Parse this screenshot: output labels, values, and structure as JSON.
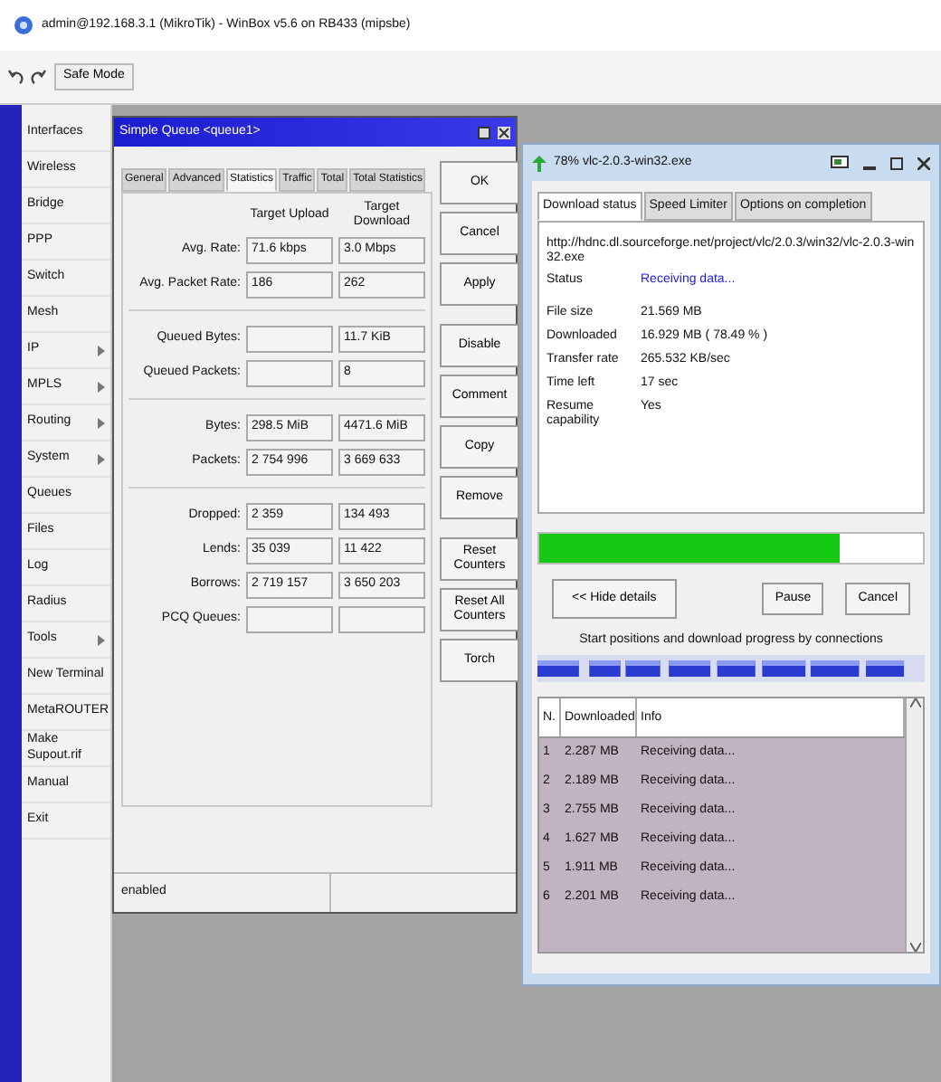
{
  "window": {
    "title": "admin@192.168.3.1 (MikroTik) - WinBox v5.6 on RB433 (mipsbe)"
  },
  "toolbar": {
    "buttons": [
      "Safe Mode"
    ]
  },
  "sidebar": {
    "items": [
      {
        "label": "Interfaces",
        "submenu": false
      },
      {
        "label": "Wireless",
        "submenu": false
      },
      {
        "label": "Bridge",
        "submenu": false
      },
      {
        "label": "PPP",
        "submenu": false
      },
      {
        "label": "Switch",
        "submenu": false
      },
      {
        "label": "Mesh",
        "submenu": false
      },
      {
        "label": "IP",
        "submenu": true
      },
      {
        "label": "MPLS",
        "submenu": true
      },
      {
        "label": "Routing",
        "submenu": true
      },
      {
        "label": "System",
        "submenu": true
      },
      {
        "label": "Queues",
        "submenu": false
      },
      {
        "label": "Files",
        "submenu": false
      },
      {
        "label": "Log",
        "submenu": false
      },
      {
        "label": "Radius",
        "submenu": false
      },
      {
        "label": "Tools",
        "submenu": true
      },
      {
        "label": "New Terminal",
        "submenu": false
      },
      {
        "label": "MetaROUTER",
        "submenu": false
      },
      {
        "label": "Make Supout.rif",
        "submenu": false
      },
      {
        "label": "Manual",
        "submenu": false
      },
      {
        "label": "Exit",
        "submenu": false
      }
    ]
  },
  "queue_dialog": {
    "title": "Simple Queue <queue1>",
    "tabs": [
      {
        "label": "General",
        "selected": false
      },
      {
        "label": "Advanced",
        "selected": false
      },
      {
        "label": "Statistics",
        "selected": true
      },
      {
        "label": "Traffic",
        "selected": false
      },
      {
        "label": "Total",
        "selected": false
      },
      {
        "label": "Total Statistics",
        "selected": false
      }
    ],
    "columns": [
      "Target Upload",
      "Target Download"
    ],
    "groups": [
      [
        {
          "label": "Avg. Rate:",
          "upload": "71.6 kbps",
          "download": "3.0 Mbps"
        },
        {
          "label": "Avg. Packet Rate:",
          "upload": "186",
          "download": "262"
        }
      ],
      [
        {
          "label": "Queued Bytes:",
          "download": "11.7 KiB"
        },
        {
          "label": "Queued Packets:",
          "download": "8"
        }
      ],
      [
        {
          "label": "Bytes:",
          "upload": "298.5 MiB",
          "download": "4471.6 MiB"
        },
        {
          "label": "Packets:",
          "upload": "2 754 996",
          "download": "3 669 633"
        }
      ],
      [
        {
          "label": "Dropped:",
          "upload": "2 359",
          "download": "134 493"
        },
        {
          "label": "Lends:",
          "upload": "35 039",
          "download": "11 422"
        },
        {
          "label": "Borrows:",
          "upload": "2 719 157",
          "download": "3 650 203"
        },
        {
          "label": "PCQ Queues:"
        }
      ]
    ],
    "button_groups": [
      [
        "OK",
        "Cancel",
        "Apply"
      ],
      [
        "Disable",
        "Comment",
        "Copy",
        "Remove"
      ],
      [
        "Reset Counters",
        "Reset All Counters",
        "Torch"
      ]
    ],
    "status": "enabled"
  },
  "download_window": {
    "title": "78% vlc-2.0.3-win32.exe",
    "tabs": [
      {
        "label": "Download status",
        "selected": true
      },
      {
        "label": "Speed Limiter",
        "selected": false
      },
      {
        "label": "Options on completion",
        "selected": false
      }
    ],
    "url": "http://hdnc.dl.sourceforge.net/project/vlc/2.0.3/win32/vlc-2.0.3-win32.exe",
    "details": [
      {
        "label": "Status",
        "value": "Receiving data...",
        "kind": "status"
      },
      {
        "label": "File size",
        "value": "21.569  MB",
        "kind": "info"
      },
      {
        "label": "Downloaded",
        "value": "16.929  MB  ( 78.49 % )",
        "kind": "info"
      },
      {
        "label": "Transfer rate",
        "value": "265.532  KB/sec",
        "kind": "info"
      },
      {
        "label": "Time left",
        "value": "17 sec",
        "kind": "info"
      },
      {
        "label": "Resume capability",
        "value": "Yes",
        "kind": "info"
      }
    ],
    "progress": {
      "level": 0.7849
    },
    "buttons": [
      "<< Hide details",
      "Pause",
      "Cancel"
    ],
    "connections_caption": "Start positions and download progress by connections",
    "table": {
      "columns": [
        "N.",
        "Downloaded",
        "Info"
      ],
      "rows": [
        [
          "1",
          "2.287 MB",
          "Receiving data..."
        ],
        [
          "2",
          "2.189 MB",
          "Receiving data..."
        ],
        [
          "3",
          "2.755 MB",
          "Receiving data..."
        ],
        [
          "4",
          "1.627 MB",
          "Receiving data..."
        ],
        [
          "5",
          "1.911 MB",
          "Receiving data..."
        ],
        [
          "6",
          "2.201 MB",
          "Receiving data..."
        ]
      ]
    }
  }
}
